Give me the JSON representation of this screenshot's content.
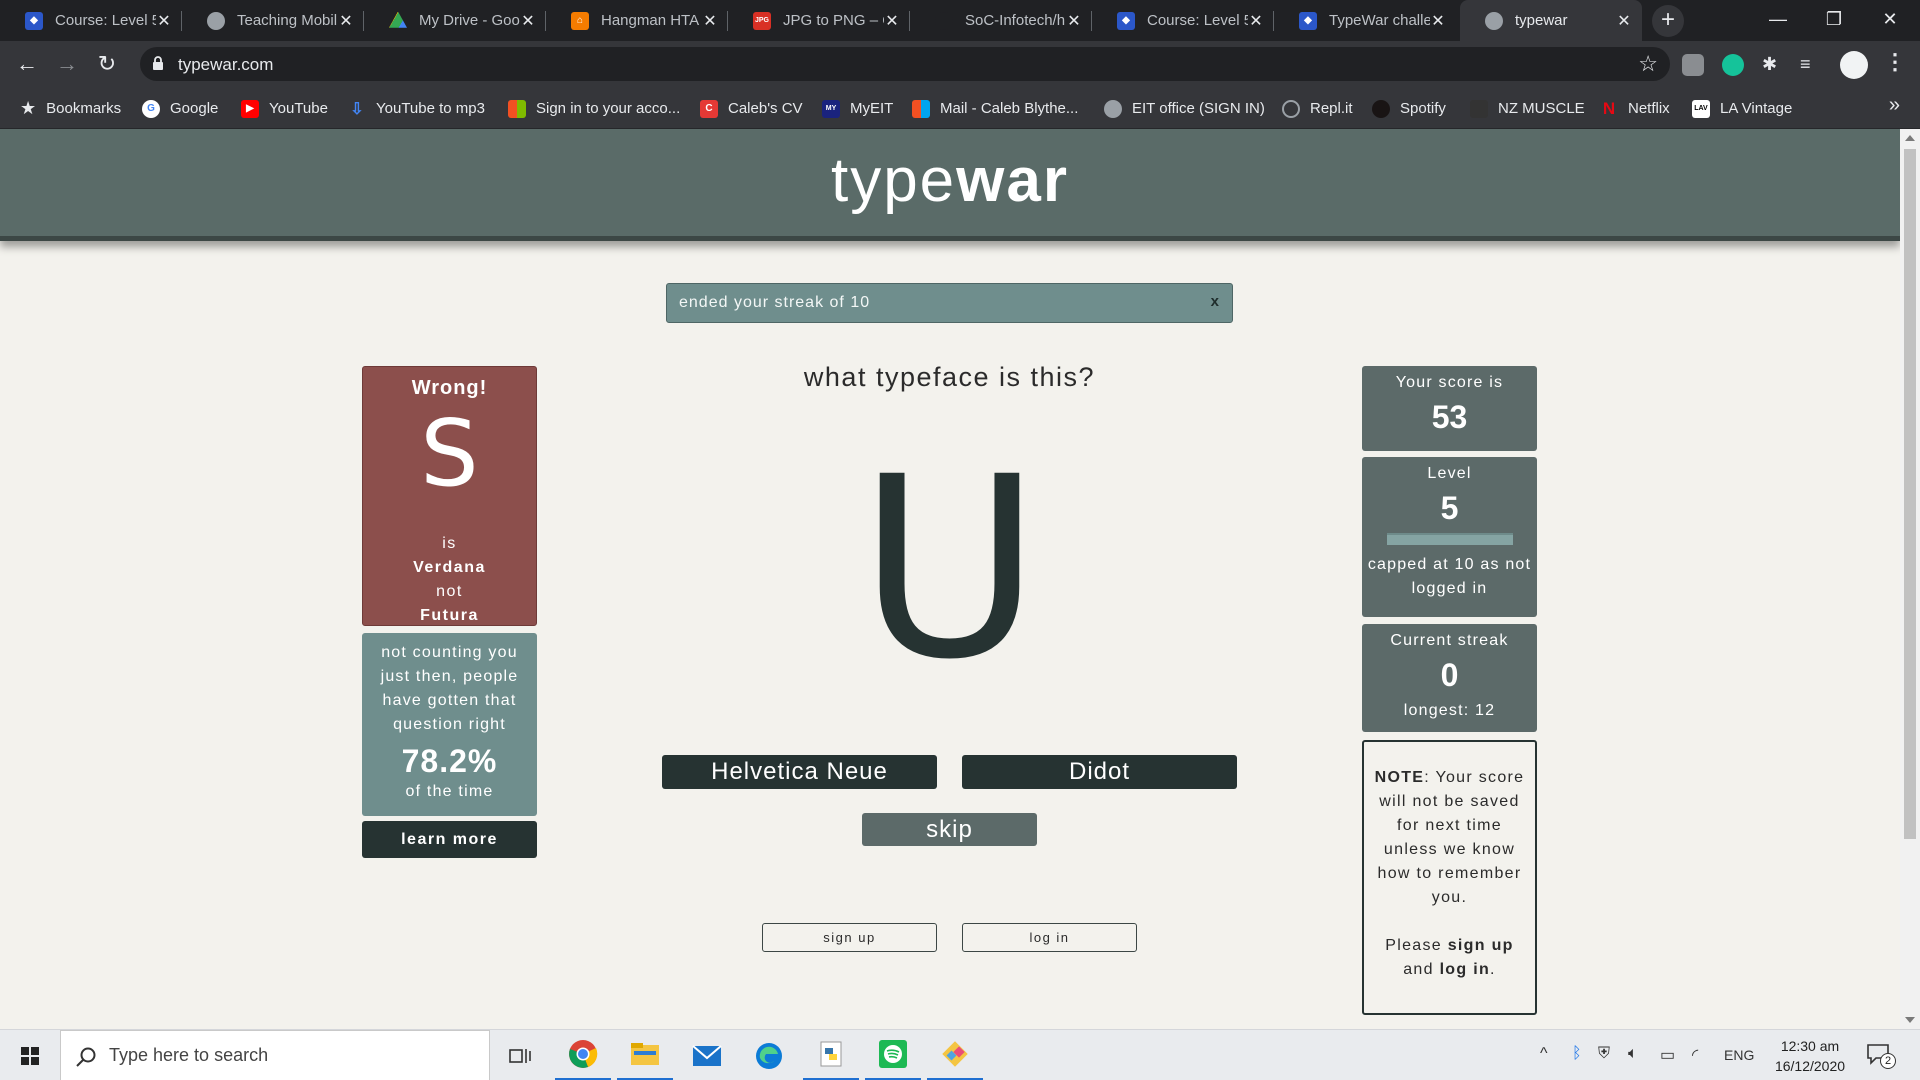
{
  "browser": {
    "tabs": [
      {
        "title": "Course: Level 5",
        "favicon_color": "#2b57c9",
        "active": false
      },
      {
        "title": "Teaching Mobil",
        "favicon_color": "#9aa0a6",
        "active": false
      },
      {
        "title": "My Drive - Goo",
        "favicon_color": "#34a853",
        "active": false
      },
      {
        "title": "Hangman HTA",
        "favicon_color": "#f57c00",
        "active": false
      },
      {
        "title": "JPG to PNG – C",
        "favicon_color": "#d93025",
        "active": false
      },
      {
        "title": "SoC-Infotech/h",
        "favicon_color": "#202124",
        "active": false
      },
      {
        "title": "Course: Level 5",
        "favicon_color": "#2b57c9",
        "active": false
      },
      {
        "title": "TypeWar challe",
        "favicon_color": "#2b57c9",
        "active": false
      },
      {
        "title": "typewar",
        "favicon_color": "#9aa0a6",
        "active": true
      }
    ],
    "url": "typewar.com",
    "bookmarks": [
      {
        "label": "Bookmarks",
        "icon": "star-icon",
        "color": "#e8eaed"
      },
      {
        "label": "Google",
        "icon": "google-icon",
        "color": "#ffffff"
      },
      {
        "label": "YouTube",
        "icon": "youtube-icon",
        "color": "#ff0000"
      },
      {
        "label": "YouTube to mp3",
        "icon": "download-icon",
        "color": "#4285f4"
      },
      {
        "label": "Sign in to your acco...",
        "icon": "microsoft-icon",
        "color": "#f25022"
      },
      {
        "label": "Caleb's CV",
        "icon": "canva-icon",
        "color": "#e53935"
      },
      {
        "label": "MyEIT",
        "icon": "myeit-icon",
        "color": "#1a237e"
      },
      {
        "label": "Mail - Caleb Blythe...",
        "icon": "microsoft-icon",
        "color": "#f25022"
      },
      {
        "label": "EIT office (SIGN IN)",
        "icon": "globe-icon",
        "color": "#9aa0a6"
      },
      {
        "label": "Repl.it",
        "icon": "replit-icon",
        "color": "#9aa0a6"
      },
      {
        "label": "Spotify",
        "icon": "spotify-icon",
        "color": "#1db954"
      },
      {
        "label": "NZ MUSCLE",
        "icon": "nzmuscle-icon",
        "color": "#333333"
      },
      {
        "label": "Netflix",
        "icon": "netflix-icon",
        "color": "#e50914"
      },
      {
        "label": "LA Vintage",
        "icon": "lav-icon",
        "color": "#ffffff"
      }
    ]
  },
  "site": {
    "title_light": "type",
    "title_bold": "war",
    "colors": {
      "header": "#5a6b68",
      "card_dark": "#263332",
      "wrong": "#8c4f4c",
      "teal": "#6f8e8d",
      "slate": "#5c6a69"
    }
  },
  "alert": {
    "message": "ended your streak of 10",
    "close_label": "x"
  },
  "result": {
    "heading": "Wrong!",
    "glyph": "S",
    "line_is": "is",
    "correct_font": "Verdana",
    "line_not": "not",
    "guessed_font": "Futura"
  },
  "stats": {
    "text": "not counting you just then, people have gotten that question right",
    "percent": "78.2%",
    "tail": "of the time",
    "learn_more": "learn more"
  },
  "question": {
    "prompt": "what typeface is this?",
    "specimen_glyph": "U",
    "options": [
      "Helvetica Neue",
      "Didot"
    ],
    "skip_label": "skip"
  },
  "auth": {
    "sign_up": "sign up",
    "log_in": "log in"
  },
  "score": {
    "score_label": "Your score is",
    "score_value": "53",
    "level_label": "Level",
    "level_value": "5",
    "level_progress": 0,
    "level_note": "capped at 10 as not logged in",
    "streak_label": "Current streak",
    "streak_value": "0",
    "longest_text": "longest: 12"
  },
  "note": {
    "title": "NOTE",
    "body": ": Your score will not be saved for next time unless we know how to remember you.",
    "please": "Please ",
    "sign_up": "sign up",
    "and": " and ",
    "log_in": "log in",
    "end": "."
  },
  "taskbar": {
    "search_placeholder": "Type here to search",
    "apps": [
      "task-view-icon",
      "chrome-icon",
      "file-explorer-icon",
      "mail-icon",
      "edge-icon",
      "python-icon",
      "spotify-icon",
      "git-icon"
    ],
    "language": "ENG",
    "time": "12:30 am",
    "date": "16/12/2020",
    "notifications": "2"
  }
}
